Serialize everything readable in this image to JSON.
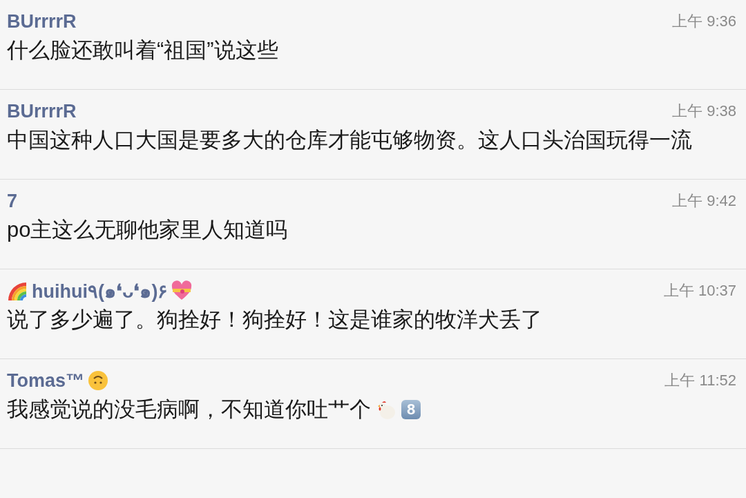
{
  "comments": [
    {
      "author": "BUrrrrR",
      "time": "上午 9:36",
      "message": "什么脸还敢叫着“祖国”说这些"
    },
    {
      "author": "BUrrrrR",
      "time": "上午 9:38",
      "message": "中国这种人口大国是要多大的仓库才能屯够物资。这人口头治国玩得一流"
    },
    {
      "author": "7",
      "time": "上午 9:42",
      "message": "po主这么无聊他家里人知道吗"
    },
    {
      "author": "huihui٩(๑❛ᴗ❛๑)۶",
      "author_lead_emoji": {
        "kind": "rainbow"
      },
      "author_emojis": [
        {
          "kind": "heart"
        }
      ],
      "time": "上午 10:37",
      "message": "说了多少遍了。狗拴好！狗拴好！这是谁家的牧洋犬丢了"
    },
    {
      "author": "Tomas™",
      "author_emojis": [
        {
          "kind": "upside-down-face"
        }
      ],
      "time": "上午 11:52",
      "message": "我感觉说的没毛病啊，不知道你吐艹个",
      "message_emojis": [
        {
          "kind": "chicken"
        },
        {
          "kind": "keycap",
          "text": "8"
        }
      ]
    }
  ]
}
